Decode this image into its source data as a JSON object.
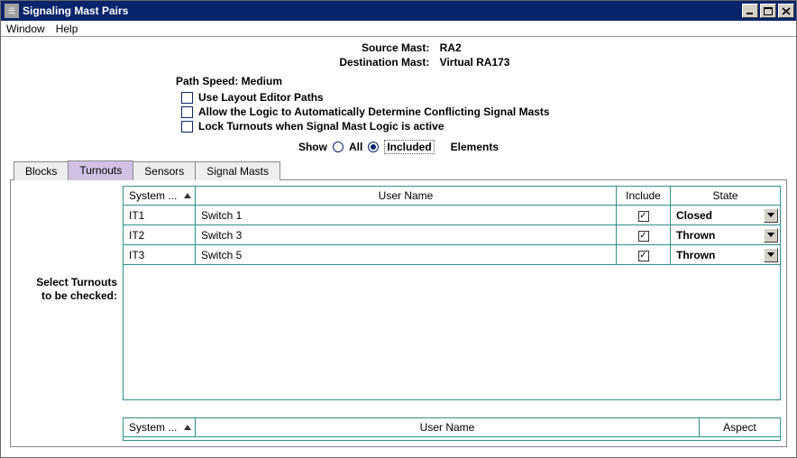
{
  "window": {
    "title": "Signaling Mast Pairs"
  },
  "menubar": {
    "window": "Window",
    "help": "Help"
  },
  "header": {
    "source_label": "Source Mast:",
    "source_value": "RA2",
    "dest_label": "Destination Mast:",
    "dest_value": "Virtual RA173"
  },
  "path_speed": "Path Speed: Medium",
  "options": {
    "use_layout_paths": "Use Layout Editor Paths",
    "auto_conflict": "Allow the Logic to Automatically Determine Conflicting Signal Masts",
    "lock_turnouts": "Lock Turnouts when Signal Mast Logic is active"
  },
  "show_row": {
    "show": "Show",
    "all": "All",
    "included": "Included",
    "elements": "Elements",
    "selected": "included"
  },
  "tabs": {
    "blocks": "Blocks",
    "turnouts": "Turnouts",
    "sensors": "Sensors",
    "signal_masts": "Signal Masts"
  },
  "side_label_line1": "Select Turnouts",
  "side_label_line2": "to be checked:",
  "tables": {
    "turnouts": {
      "columns": {
        "system": "System ...",
        "user": "User Name",
        "include": "Include",
        "state": "State"
      },
      "rows": [
        {
          "system": "IT1",
          "user": "Switch 1",
          "include": true,
          "state": "Closed"
        },
        {
          "system": "IT2",
          "user": "Switch 3",
          "include": true,
          "state": "Thrown"
        },
        {
          "system": "IT3",
          "user": "Switch 5",
          "include": true,
          "state": "Thrown"
        }
      ]
    },
    "aspect": {
      "columns": {
        "system": "System ...",
        "user": "User Name",
        "aspect": "Aspect"
      }
    }
  }
}
